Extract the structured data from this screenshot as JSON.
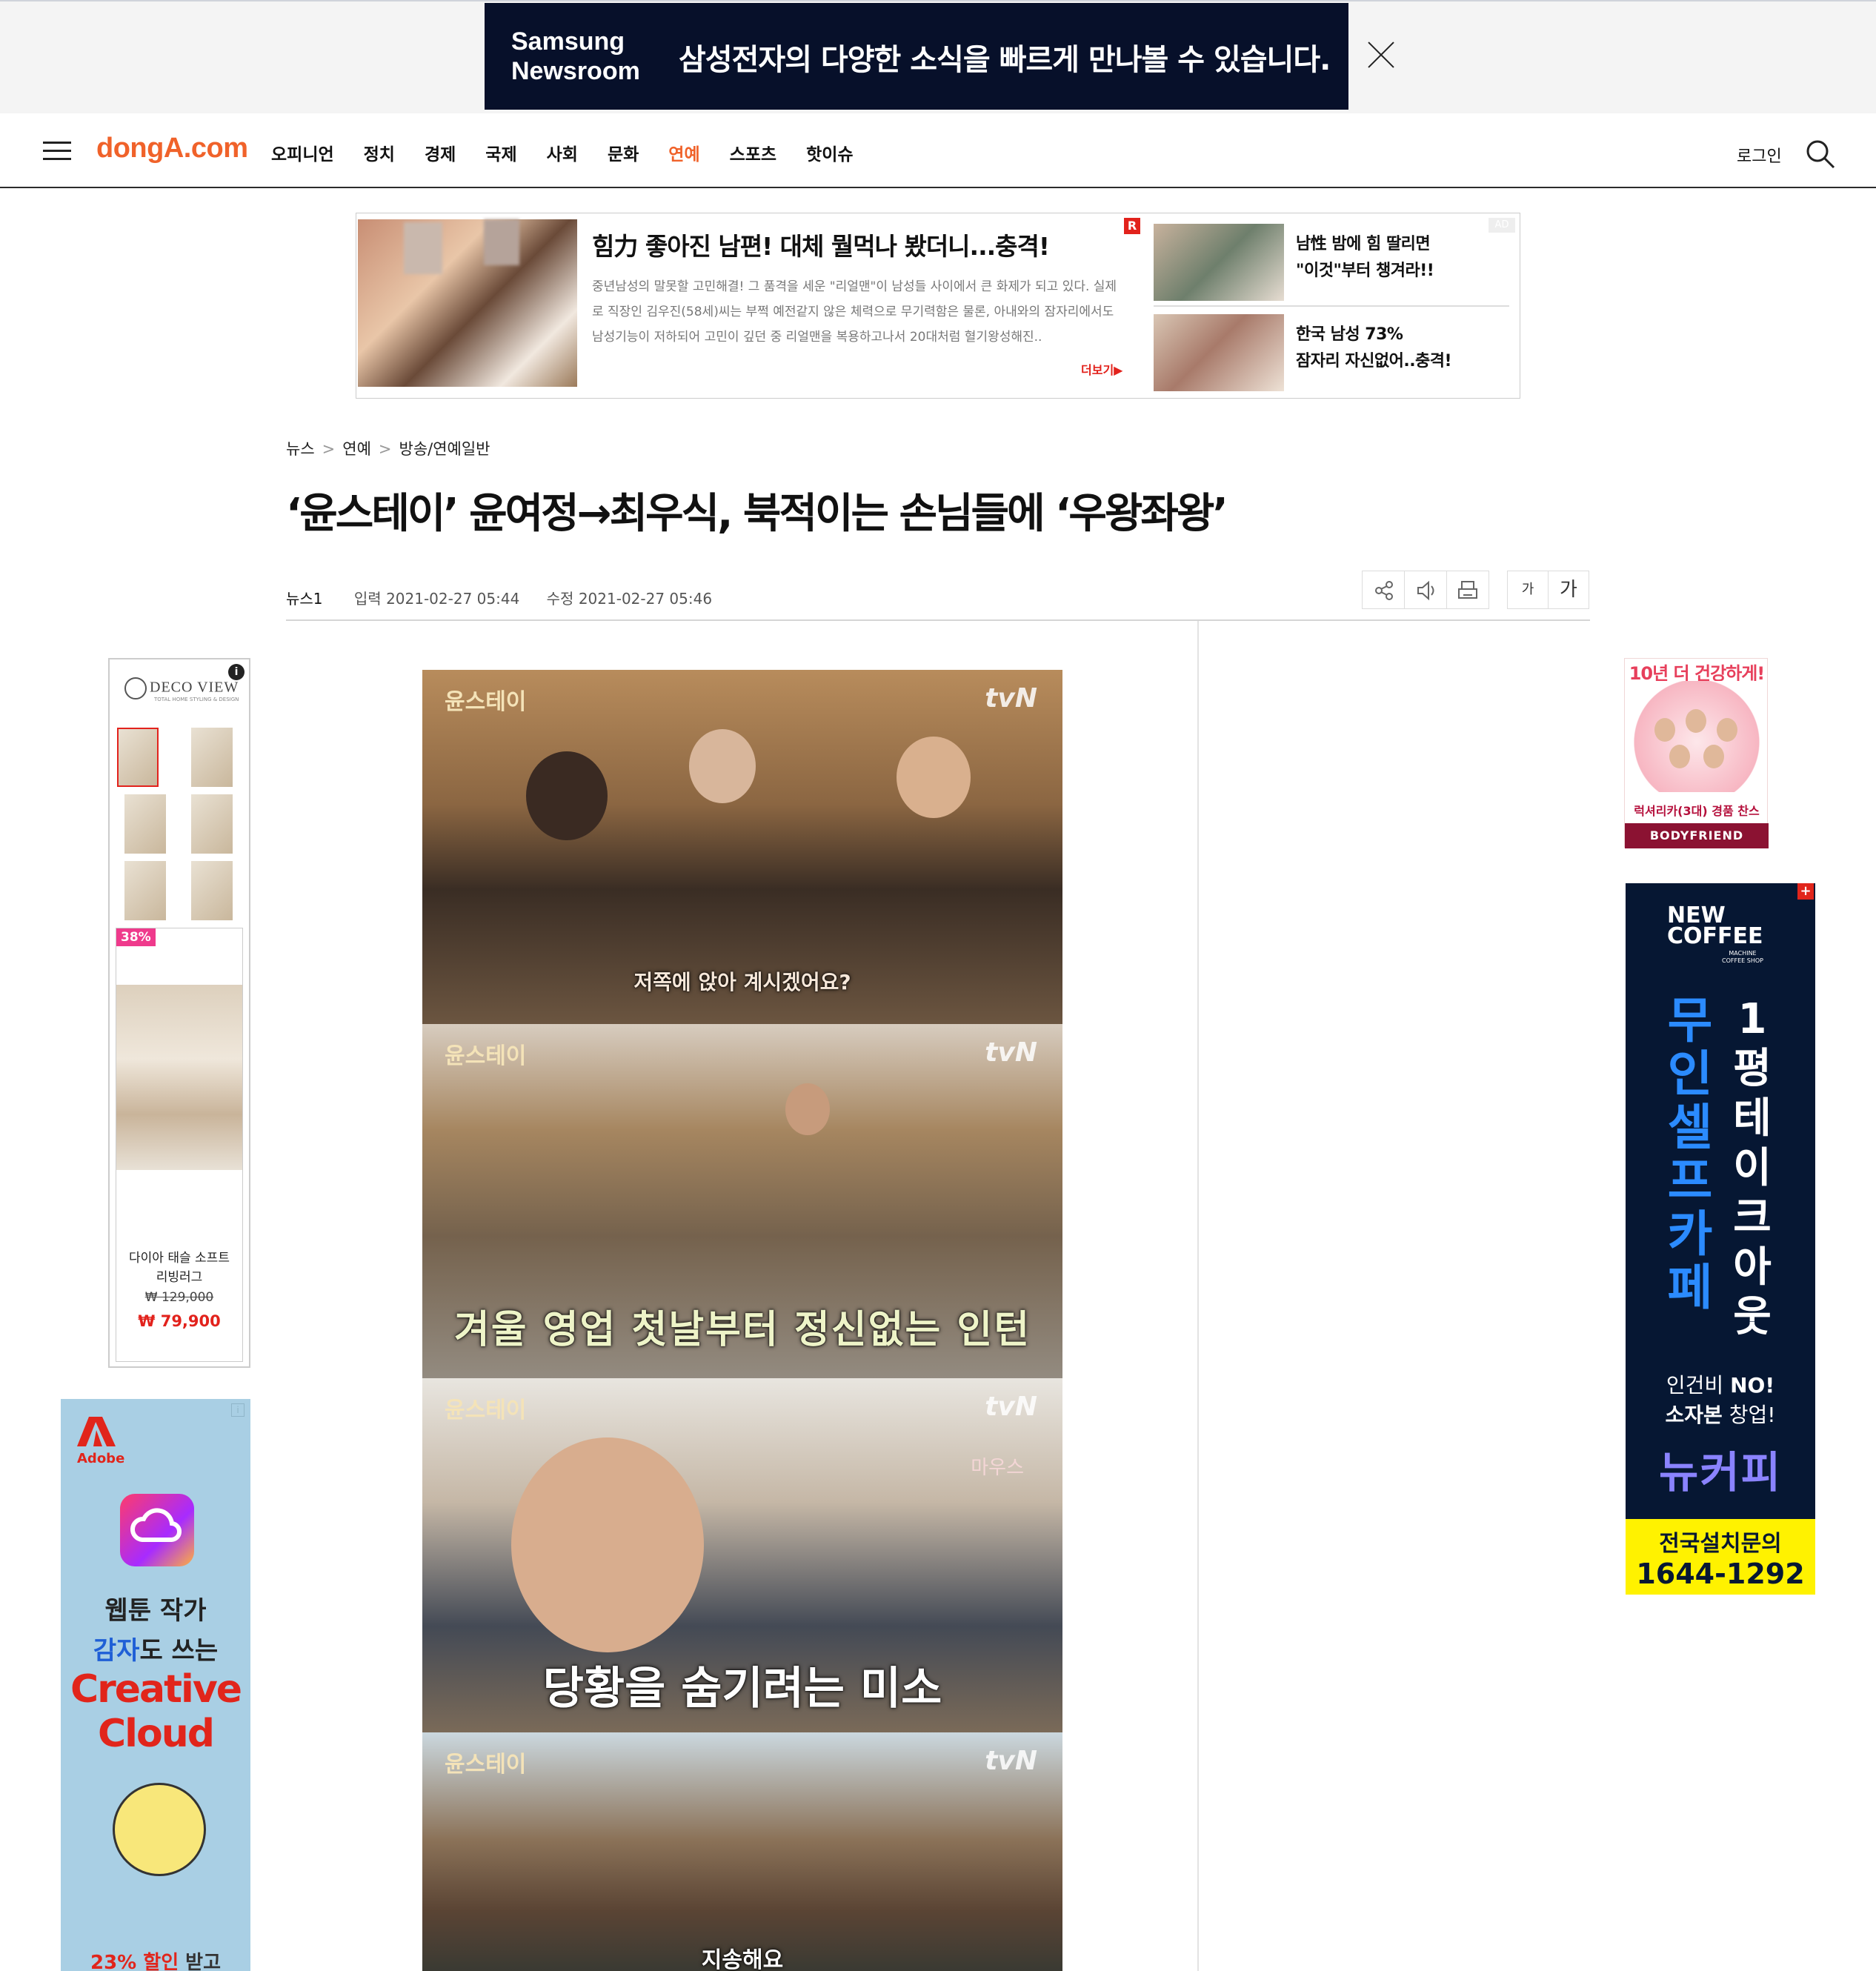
{
  "top_banner": {
    "logo_line1": "Samsung",
    "logo_line2": "Newsroom",
    "message": "삼성전자의 다양한 소식을 빠르게 만나볼 수 있습니다."
  },
  "nav": {
    "logo": "dongA.com",
    "menu": [
      "오피니언",
      "정치",
      "경제",
      "국제",
      "사회",
      "문화",
      "연예",
      "스포츠",
      "핫이슈"
    ],
    "active_menu": "연예",
    "login": "로그인",
    "accent_color": "#f0622a"
  },
  "ad_box": {
    "title": "힘力 좋아진 남편! 대체 뭘먹나 봤더니...충격!",
    "body": "중년남성의 말못할 고민해결! 그 품격을 세운 \"리얼맨\"이 남성들 사이에서 큰 화제가 되고 있다. 실제로 직장인 김우진(58세)씨는 부쩍 예전같지 않은 체력으로 무기력함은 물론, 아내와의 잠자리에서도 남성기능이 저하되어 고민이 깊던 중 리얼맨을 복용하고나서 20대처럼 혈기왕성해진..",
    "more": "더보기▶",
    "r_badge": "R",
    "ad_label": "AD",
    "side_items": [
      {
        "line1": "남性 밤에 힘 딸리면",
        "line2": "\"이것\"부터 챙겨라!!"
      },
      {
        "line1": "한국 남성 73%",
        "line2": "잠자리 자신없어..충격!"
      }
    ]
  },
  "breadcrumb": [
    "뉴스",
    "연예",
    "방송/연예일반"
  ],
  "article": {
    "headline": "‘윤스테이’ 윤여정→최우식, 북적이는 손님들에 ‘우왕좌왕’",
    "source": "뉴스1",
    "input_label": "입력",
    "input_time": "2021-02-27 05:44",
    "modified_label": "수정",
    "modified_time": "2021-02-27 05:46",
    "font_small": "가",
    "font_large": "가",
    "images": [
      {
        "show": "윤스테이",
        "channel": "tvN",
        "caption": "저쪽에 앉아 계시겠어요?"
      },
      {
        "show": "윤스테이",
        "channel": "tvN",
        "caption": "겨울 영업 첫날부터 정신없는 인턴"
      },
      {
        "show": "윤스테이",
        "channel": "tvN",
        "caption": "당황을 숨기려는 미소",
        "side_text": "마우스"
      },
      {
        "show": "윤스테이",
        "channel": "tvN",
        "caption": "지송해요"
      }
    ]
  },
  "deco_ad": {
    "brand": "DECO VIEW",
    "brand_sub": "TOTAL HOME STYLING & DESIGN",
    "info": "i",
    "discount": "38%",
    "product_name_line1": "다이아 태슬 소프트",
    "product_name_line2": "리빙러그",
    "old_price": "₩ 129,000",
    "new_price": "₩ 79,900"
  },
  "adobe_ad": {
    "brand": "Adobe",
    "line1": "웹툰 작가",
    "line2_highlight": "감자",
    "line2_rest": "도 쓰는",
    "line3a": "Creative",
    "line3b": "Cloud",
    "line4_highlight": "23% 할인",
    "line4_rest": "받고"
  },
  "bodyfriend_ad": {
    "top": "10년 더 건강하게!",
    "line": "럭셔리카(3대) 경품 찬스",
    "brand": "BODYFRIEND"
  },
  "newcoffee_ad": {
    "logo": "NEW COFFEE",
    "logo_sub": "MACHINE COFFEE SHOP",
    "vertical_left": [
      "무",
      "인",
      "셀",
      "프",
      "카",
      "페"
    ],
    "vertical_right": [
      "1",
      "평",
      "테",
      "이",
      "크",
      "아",
      "웃"
    ],
    "line1_a": "인건비 ",
    "line1_b": "NO!",
    "line2_a": "소자본",
    "line2_b": " 창업!",
    "brand": "뉴커피",
    "contact_label": "전국설치문의",
    "phone": "1644-1292"
  }
}
